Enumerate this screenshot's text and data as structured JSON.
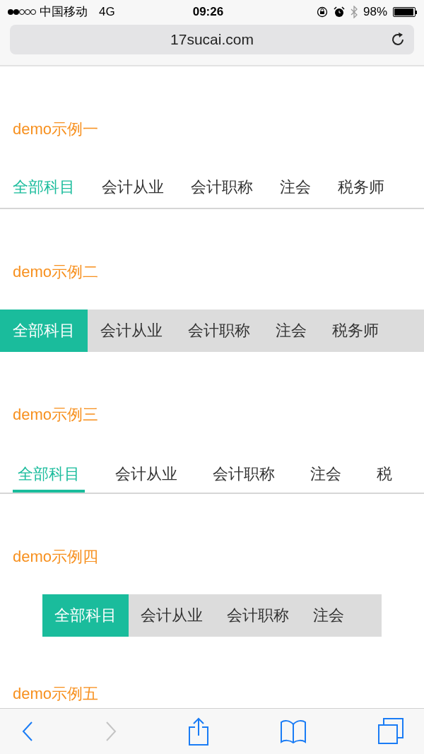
{
  "status_bar": {
    "carrier": "中国移动",
    "network": "4G",
    "time": "09:26",
    "battery": "98%"
  },
  "address_bar": {
    "url": "17sucai.com"
  },
  "demos": [
    {
      "title": "demo示例一",
      "kind": "plain",
      "tabs": [
        {
          "label": "全部科目",
          "selected": true
        },
        {
          "label": "会计从业",
          "selected": false
        },
        {
          "label": "会计职称",
          "selected": false
        },
        {
          "label": "注会",
          "selected": false
        },
        {
          "label": "税务师",
          "selected": false
        }
      ]
    },
    {
      "title": "demo示例二",
      "kind": "filled",
      "tabs": [
        {
          "label": "全部科目",
          "selected": true
        },
        {
          "label": "会计从业",
          "selected": false
        },
        {
          "label": "会计职称",
          "selected": false
        },
        {
          "label": "注会",
          "selected": false
        },
        {
          "label": "税务师",
          "selected": false
        }
      ]
    },
    {
      "title": "demo示例三",
      "kind": "underline",
      "tabs": [
        {
          "label": "全部科目",
          "selected": true
        },
        {
          "label": "会计从业",
          "selected": false
        },
        {
          "label": "会计职称",
          "selected": false
        },
        {
          "label": "注会",
          "selected": false
        },
        {
          "label": "税",
          "selected": false
        }
      ]
    },
    {
      "title": "demo示例四",
      "kind": "boxed",
      "tabs": [
        {
          "label": "全部科目",
          "selected": true
        },
        {
          "label": "会计从业",
          "selected": false
        },
        {
          "label": "会计职称",
          "selected": false
        },
        {
          "label": "注会",
          "selected": false
        }
      ]
    },
    {
      "title": "demo示例五"
    }
  ],
  "toolbar": [
    {
      "kind": "back",
      "disabled": false
    },
    {
      "kind": "forward",
      "disabled": true
    },
    {
      "kind": "share",
      "disabled": false
    },
    {
      "kind": "bookmarks",
      "disabled": false
    },
    {
      "kind": "tabs",
      "disabled": false
    }
  ]
}
